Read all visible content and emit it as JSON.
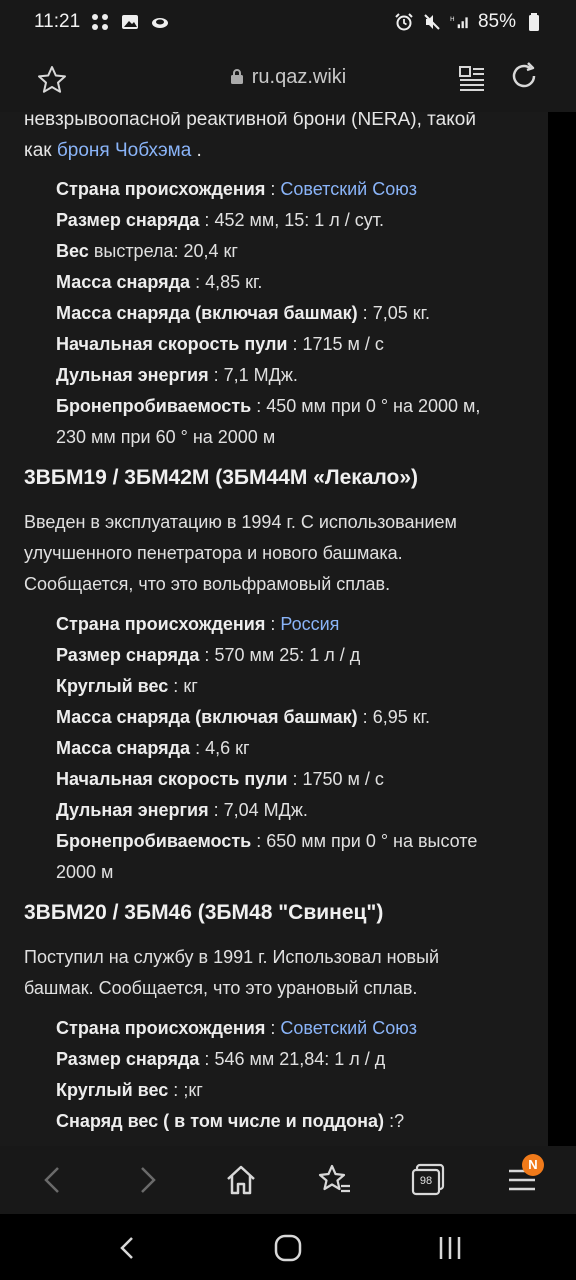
{
  "status_bar": {
    "time": "11:21",
    "battery": "85%"
  },
  "browser": {
    "url": "ru.qaz.wiki"
  },
  "article": {
    "intro_line1": "невзрывоопасной реактивной брони (NERA), такой",
    "intro_line2_prefix": "как ",
    "intro_link": "броня Чобхэма",
    "intro_line2_suffix": " .",
    "section1_specs": [
      {
        "label": "Страна происхождения",
        "sep": " : ",
        "value": "Советский Союз",
        "value_is_link": true
      },
      {
        "label": "Размер снаряда",
        "sep": " : ",
        "value": "452 мм, 15: 1 л / сут."
      },
      {
        "label": "Вес",
        "sep": " ",
        "value": "выстрела: 20,4 кг"
      },
      {
        "label": "Масса снаряда",
        "sep": " : ",
        "value": "4,85 кг."
      },
      {
        "label": "Масса снаряда (включая башмак)",
        "sep": " : ",
        "value": "7,05 кг."
      },
      {
        "label": "Начальная скорость пули",
        "sep": " : ",
        "value": "1715 м / с"
      },
      {
        "label": "Дульная энергия",
        "sep": " : ",
        "value": "7,1 МДж."
      },
      {
        "label": "Бронепробиваемость",
        "sep": " : ",
        "value": "450 мм при 0 ° на 2000 м,",
        "value2": "230 мм при 60 ° на 2000 м"
      }
    ],
    "heading2": "3ВБМ19 / 3БМ42М (3БМ44М «Лекало»)",
    "para2": [
      "Введен в эксплуатацию в 1994 г. С использованием",
      "улучшенного пенетратора и нового башмака.",
      "Сообщается, что это вольфрамовый сплав."
    ],
    "section2_specs": [
      {
        "label": "Страна происхождения",
        "sep": " : ",
        "value": "Россия",
        "value_is_link": true
      },
      {
        "label": "Размер снаряда",
        "sep": " : ",
        "value": "570 мм 25: 1 л / д"
      },
      {
        "label": "Круглый вес",
        "sep": " : ",
        "value": "кг"
      },
      {
        "label": "Масса снаряда (включая башмак)",
        "sep": " : ",
        "value": "6,95 кг."
      },
      {
        "label": "Масса снаряда",
        "sep": " : ",
        "value": "4,6 кг"
      },
      {
        "label": "Начальная скорость пули",
        "sep": " : ",
        "value": "1750 м / с"
      },
      {
        "label": "Дульная энергия",
        "sep": " : ",
        "value": "7,04 МДж."
      },
      {
        "label": "Бронепробиваемость",
        "sep": " : ",
        "value": "650 мм при 0 ° на высоте",
        "value2": "2000 м"
      }
    ],
    "heading3": "3ВБМ20 / 3БМ46 (3БМ48 \"Свинец\")",
    "para3": [
      "Поступил на службу в 1991 г. Использовал новый",
      "башмак. Сообщается, что это урановый сплав."
    ],
    "section3_specs": [
      {
        "label": "Страна происхождения",
        "sep": " : ",
        "value": "Советский Союз",
        "value_is_link": true
      },
      {
        "label": "Размер снаряда",
        "sep": " : ",
        "value": "546 мм 21,84: 1 л / д"
      },
      {
        "label": "Круглый вес",
        "sep": " : ",
        "value": ";кг"
      },
      {
        "label": "Снаряд вес ( в том числе и поддона)",
        "sep": " :",
        "value": "?"
      }
    ]
  },
  "bottom_bar": {
    "tabs_count": "98",
    "menu_badge": "N"
  },
  "icons": {
    "status": [
      "grid-icon",
      "image-icon",
      "cloud-icon",
      "alarm-icon",
      "mute-icon",
      "signal-icon",
      "battery-icon"
    ],
    "top": [
      "bookmark-star-icon",
      "lock-icon",
      "reader-mode-icon",
      "reload-icon"
    ],
    "bottom": [
      "back-arrow-icon",
      "forward-arrow-icon",
      "home-icon",
      "bookmarks-icon",
      "tabs-icon",
      "menu-icon"
    ],
    "system": [
      "nav-back-icon",
      "nav-home-icon",
      "nav-recents-icon"
    ]
  },
  "colors": {
    "link": "#8ab4f8",
    "badge": "#f07a1a",
    "content_bg": "#1a1a1a",
    "bar_bg": "#181818"
  }
}
